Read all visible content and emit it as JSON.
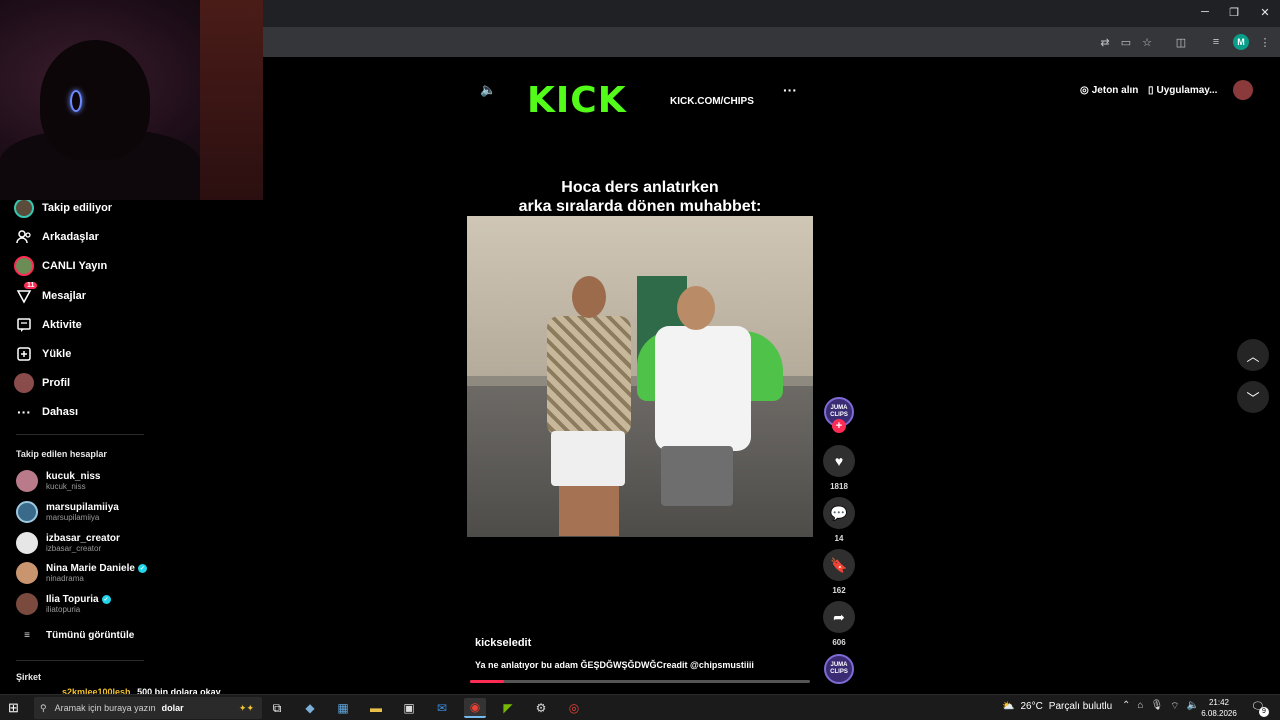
{
  "browser": {
    "window_controls": {
      "minimize": "─",
      "restore": "❐",
      "close": "✕"
    },
    "profile_initial": "M"
  },
  "sidebar": {
    "nav": [
      {
        "label": "Takip ediliyor",
        "icon": "avatar"
      },
      {
        "label": "Arkadaşlar",
        "icon": "friends-icon"
      },
      {
        "label": "CANLI Yayın",
        "icon": "avatar"
      },
      {
        "label": "Mesajlar",
        "icon": "messages-icon",
        "badge": "11"
      },
      {
        "label": "Aktivite",
        "icon": "activity-icon"
      },
      {
        "label": "Yükle",
        "icon": "upload-icon"
      },
      {
        "label": "Profil",
        "icon": "avatar"
      },
      {
        "label": "Dahası",
        "icon": "more-icon"
      }
    ],
    "following_title": "Takip edilen hesaplar",
    "following": [
      {
        "name": "kucuk_niss",
        "handle": "kucuk_niss",
        "verified": false
      },
      {
        "name": "marsupilamiiya",
        "handle": "marsupilamiiya",
        "verified": false
      },
      {
        "name": "izbasar_creator",
        "handle": "izbasar_creator",
        "verified": false
      },
      {
        "name": "Nina Marie Daniele",
        "handle": "ninadrama",
        "verified": true
      },
      {
        "name": "Ilia Topuria",
        "handle": "iliatopuria",
        "verified": true
      }
    ],
    "see_all": "Tümünü görüntüle",
    "company_title": "Şirket"
  },
  "topbar": {
    "coins": "Jeton alın",
    "app": "Uygulamay..."
  },
  "video": {
    "brand": "KICK",
    "brand_url": "KICK.COM/CHIPS",
    "caption_line1": "Hoca ders anlatırken",
    "caption_line2": "arka sıralarda dönen muhabbet:",
    "author": "kickseledit",
    "description": "Ya ne anlatıyor bu adam ĞEŞDĞWŞĞDWĞCreadit @chipsmustiiii",
    "progress": 0.1,
    "creator_avatar_text": "JUMA CLIPS",
    "likes": "1818",
    "comments": "14",
    "saves": "162",
    "shares": "606"
  },
  "chat_overlay": {
    "user": "s2kmlee100lesh",
    "message": "500 bin dolara okay"
  },
  "taskbar": {
    "search_text": "Aramak için buraya yazın",
    "search_overlay": "dolar",
    "weather_temp": "26°C",
    "weather_text": "Parçalı bulutlu",
    "time": "21:42",
    "date": "6.08.2026",
    "notifications": "9"
  },
  "colors": {
    "kick_green": "#53fc18",
    "tiktok_red": "#fe2c55"
  }
}
